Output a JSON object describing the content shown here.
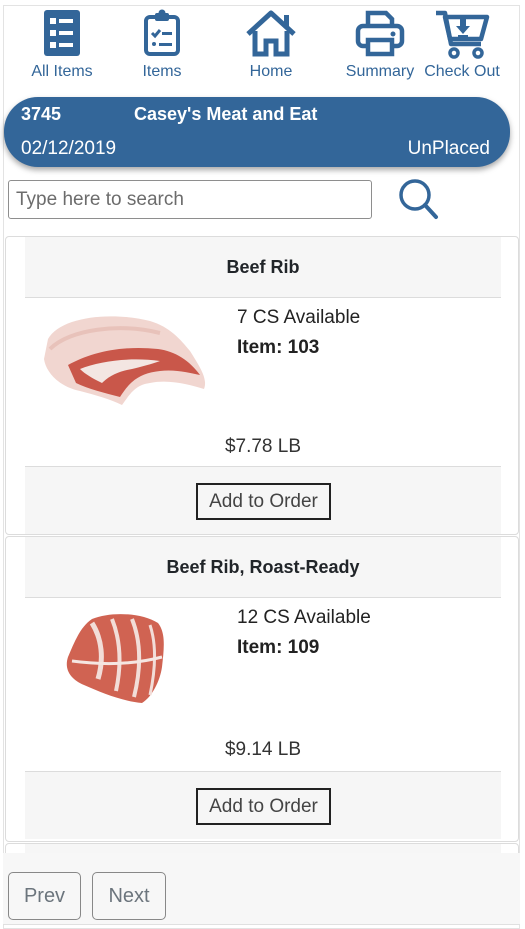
{
  "nav": {
    "items": [
      {
        "label": "All Items",
        "icon": "list-icon"
      },
      {
        "label": "Items",
        "icon": "clipboard-check-icon"
      },
      {
        "label": "Home",
        "icon": "home-icon"
      },
      {
        "label": "Summary",
        "icon": "printer-icon"
      },
      {
        "label": "Check Out",
        "icon": "cart-download-icon"
      }
    ]
  },
  "order": {
    "number": "3745",
    "customer": "Casey's Meat and Eat",
    "date": "02/12/2019",
    "status": "UnPlaced"
  },
  "search": {
    "value": "",
    "placeholder": "Type here to search",
    "icon": "search-icon"
  },
  "colors": {
    "brand": "#336699",
    "card_band": "#f6f6f6"
  },
  "products": [
    {
      "name": "Beef Rib",
      "available": "7 CS Available",
      "item": "Item: 103",
      "price": "$7.78 LB",
      "image": "beef-rib-image",
      "button": "Add to Order"
    },
    {
      "name": "Beef Rib, Roast-Ready",
      "available": "12 CS Available",
      "item": "Item: 109",
      "price": "$9.14 LB",
      "image": "beef-rib-roast-ready-image",
      "button": "Add to Order"
    }
  ],
  "pager": {
    "prev": "Prev",
    "next": "Next"
  }
}
